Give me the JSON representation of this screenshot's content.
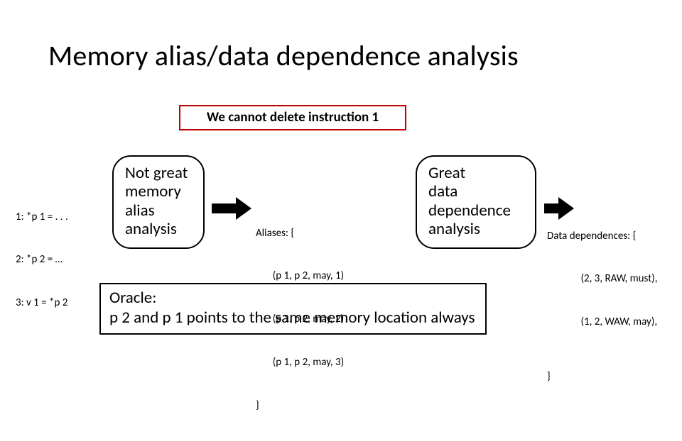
{
  "title": "Memory alias/data dependence analysis",
  "callout": "We cannot delete instruction 1",
  "code": {
    "l1": "1: *p 1 = . . .",
    "l2": "2: *p 2 = …",
    "l3": "3: v 1 = *p 2"
  },
  "node_alias": "Not great memory alias analysis",
  "node_dep": "Great\ndata dependence analysis",
  "aliases": {
    "head": "Aliases: {",
    "r1": "       (p 1, p 2, may, 1)",
    "r2": "       (p 1, p 2, may, 2)",
    "r3": "       (p 1, p 2, may, 3)",
    "tail": "}"
  },
  "deps": {
    "head": "Data dependences: {",
    "r1": "              (2, 3, RAW, must),",
    "r2": "              (1, 2, WAW, may),",
    "tail": "}"
  },
  "oracle_l1": "Oracle:",
  "oracle_l2": "p 2 and p 1 points to the same memory location always"
}
